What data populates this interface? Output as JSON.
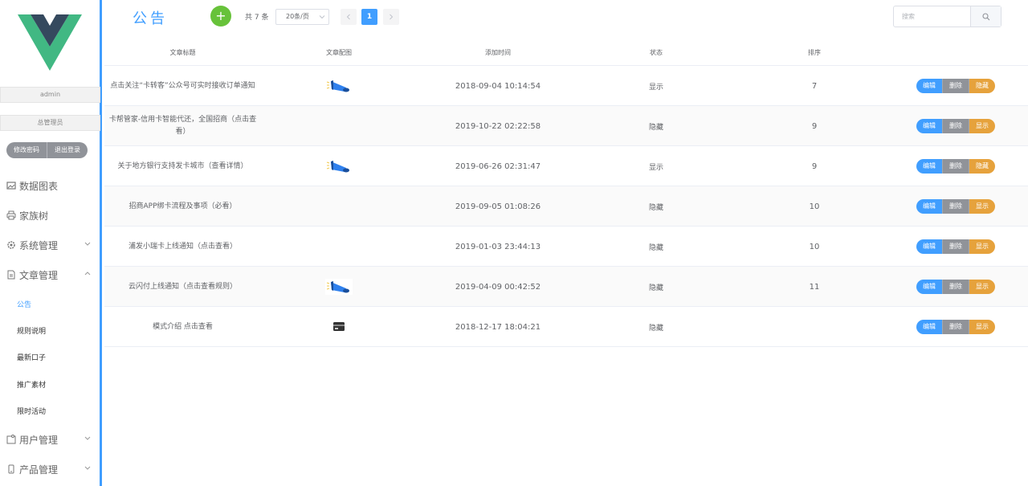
{
  "sidebar": {
    "username": "admin",
    "role": "总管理员",
    "change_password": "修改密码",
    "logout": "退出登录",
    "menu": [
      {
        "label": "数据图表",
        "icon": "picture-icon"
      },
      {
        "label": "家族树",
        "icon": "printer-icon"
      },
      {
        "label": "系统管理",
        "icon": "gear-icon"
      },
      {
        "label": "文章管理",
        "icon": "document-icon"
      },
      {
        "label": "用户管理",
        "icon": "user-card-icon"
      },
      {
        "label": "产品管理",
        "icon": "phone-icon"
      }
    ],
    "submenu": [
      "公告",
      "规则说明",
      "最新口子",
      "推广素材",
      "限时活动"
    ]
  },
  "header": {
    "title": "公告",
    "add_symbol": "+",
    "total": "共 7 条",
    "page_size": "20条/页",
    "current_page": "1",
    "search_placeholder": "搜索"
  },
  "table": {
    "columns": [
      "文章标题",
      "文章配图",
      "添加时间",
      "状态",
      "排序"
    ],
    "actions": {
      "edit": "编辑",
      "delete": "删除"
    },
    "rows": [
      {
        "title": "点击关注“卡转客”公众号可实时接收订单通知",
        "image": "megaphone",
        "time": "2018-09-04 10:14:54",
        "status": "显示",
        "sort": "7",
        "toggle": "隐藏"
      },
      {
        "title": "卡帮管家-信用卡智能代还，全国招商（点击查看）",
        "image": "",
        "time": "2019-10-22 02:22:58",
        "status": "隐藏",
        "sort": "9",
        "toggle": "显示"
      },
      {
        "title": "关于地方银行支持发卡城市（查看详情）",
        "image": "megaphone",
        "time": "2019-06-26 02:31:47",
        "status": "显示",
        "sort": "9",
        "toggle": "隐藏"
      },
      {
        "title": "招商APP绑卡流程及事项（必看）",
        "image": "",
        "time": "2019-09-05 01:08:26",
        "status": "隐藏",
        "sort": "10",
        "toggle": "显示"
      },
      {
        "title": "浦发小瑞卡上线通知（点击查看）",
        "image": "",
        "time": "2019-01-03 23:44:13",
        "status": "隐藏",
        "sort": "10",
        "toggle": "显示"
      },
      {
        "title": "云闪付上线通知（点击查看规则）",
        "image": "megaphone",
        "time": "2019-04-09 00:42:52",
        "status": "隐藏",
        "sort": "11",
        "toggle": "显示"
      },
      {
        "title": "模式介绍 点击查看",
        "image": "card",
        "time": "2018-12-17 18:04:21",
        "status": "隐藏",
        "sort": "",
        "toggle": "显示"
      }
    ]
  },
  "colors": {
    "primary": "#409eff",
    "success": "#67c23a",
    "info": "#909399",
    "warning": "#e6a23c",
    "vue_green": "#41b883",
    "vue_navy": "#35495e"
  }
}
